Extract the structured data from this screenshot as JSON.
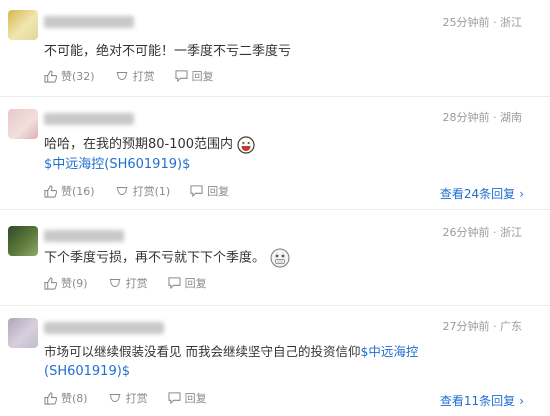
{
  "comments": [
    {
      "time": "25分钟前",
      "location": "浙江",
      "text": "不可能，绝对不可能！一季度不亏二季度亏",
      "actions": {
        "like": "赞(32)",
        "reward": "打赏",
        "reply": "回复"
      }
    },
    {
      "time": "28分钟前",
      "location": "湖南",
      "text": "哈哈，在我的预期80-100范围内",
      "emoji": "laughing-face",
      "stock": "$中远海控(SH601919)$",
      "actions": {
        "like": "赞(16)",
        "reward": "打赏(1)",
        "reply": "回复"
      },
      "more": "查看24条回复"
    },
    {
      "time": "26分钟前",
      "location": "浙江",
      "text": "下个季度亏损，再不亏就下下个季度。",
      "emoji": "grimacing-face",
      "actions": {
        "like": "赞(9)",
        "reward": "打赏",
        "reply": "回复"
      }
    },
    {
      "time": "27分钟前",
      "location": "广东",
      "text": "市场可以继续假装没看见 而我会继续坚守自己的投资信仰",
      "stock_inline": "$中远海控",
      "stock_line2": "(SH601919)$",
      "actions": {
        "like": "赞(8)",
        "reward": "打赏",
        "reply": "回复"
      },
      "more": "查看11条回复"
    }
  ],
  "separator": "·",
  "colors": {
    "link": "#1f6fd1",
    "meta": "#9a9a9a",
    "text": "#333333"
  }
}
